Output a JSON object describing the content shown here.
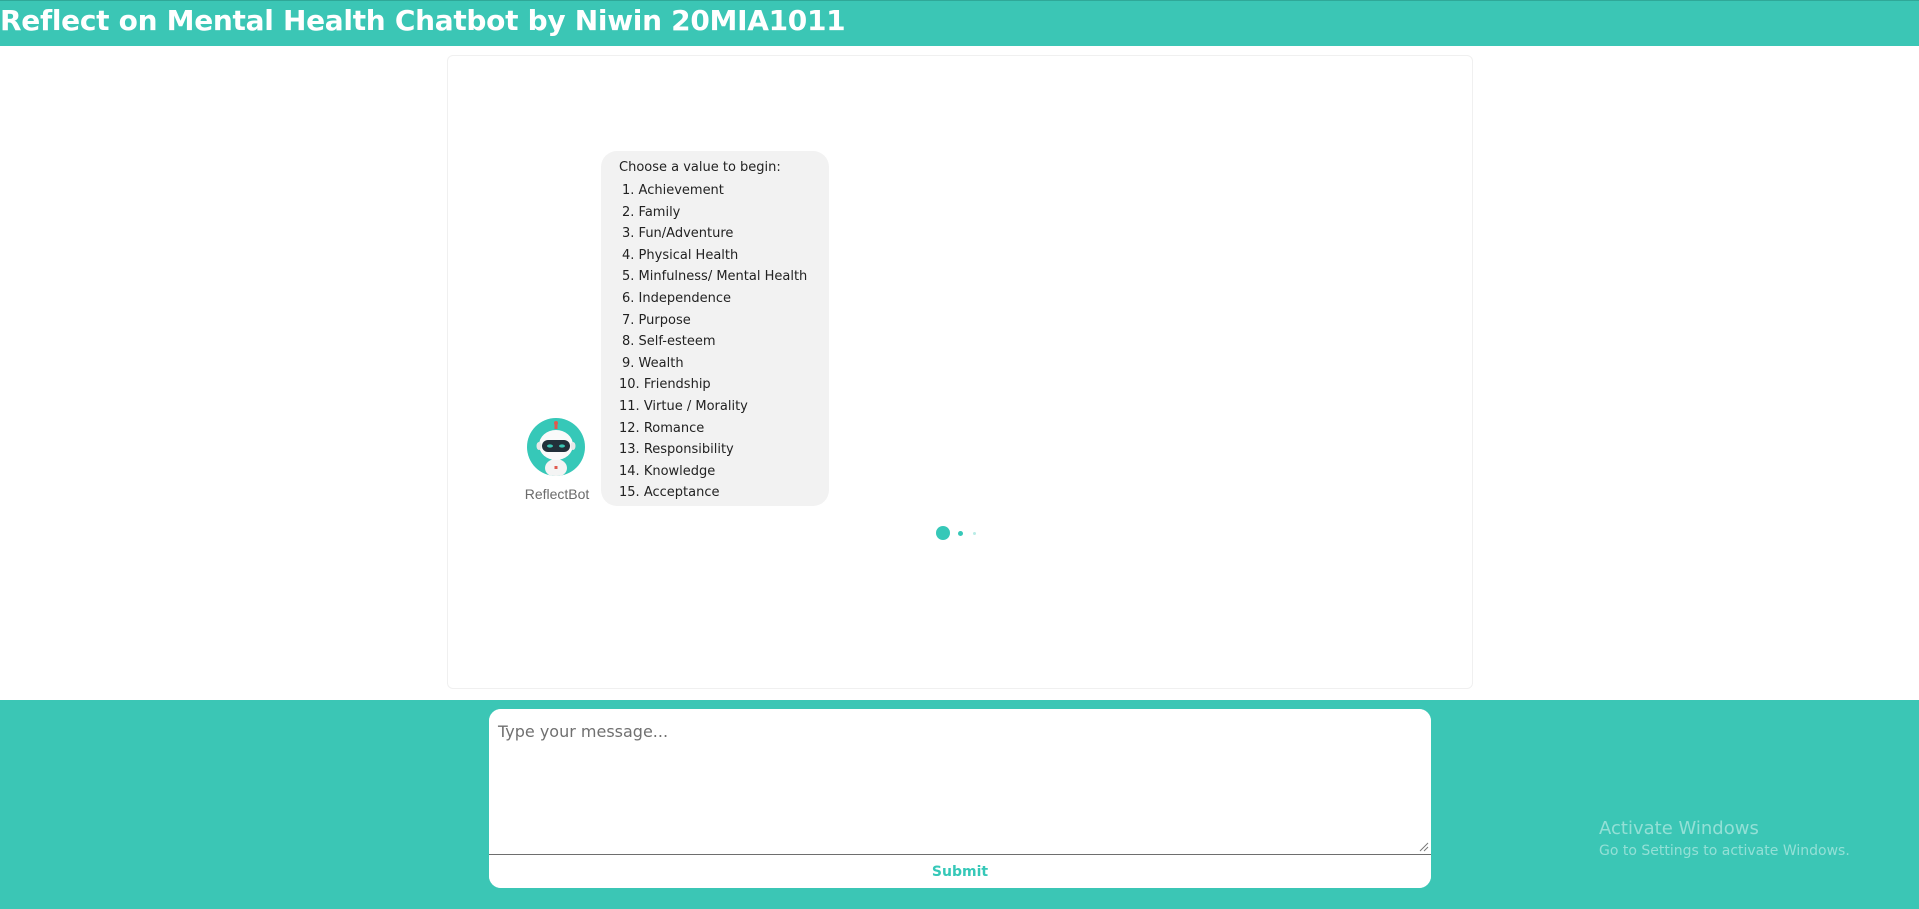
{
  "header": {
    "title": "Reflect on Mental Health Chatbot by Niwin 20MIA1011"
  },
  "bot": {
    "name": "ReflectBot",
    "avatar_icon": "robot-icon"
  },
  "message": {
    "intro": "Choose a value to begin:",
    "options": [
      {
        "num": "1.",
        "label": "Achievement"
      },
      {
        "num": "2.",
        "label": "Family"
      },
      {
        "num": "3.",
        "label": "Fun/Adventure"
      },
      {
        "num": "4.",
        "label": "Physical Health"
      },
      {
        "num": "5.",
        "label": "Minfulness/ Mental Health"
      },
      {
        "num": "6.",
        "label": "Independence"
      },
      {
        "num": "7.",
        "label": "Purpose"
      },
      {
        "num": "8.",
        "label": "Self-esteem"
      },
      {
        "num": "9.",
        "label": "Wealth"
      },
      {
        "num": "10.",
        "label": "Friendship"
      },
      {
        "num": "11.",
        "label": "Virtue / Morality"
      },
      {
        "num": "12.",
        "label": "Romance"
      },
      {
        "num": "13.",
        "label": "Responsibility"
      },
      {
        "num": "14.",
        "label": "Knowledge"
      },
      {
        "num": "15.",
        "label": "Acceptance"
      }
    ]
  },
  "composer": {
    "placeholder": "Type your message...",
    "value": "",
    "submit_label": "Submit"
  },
  "watermark": {
    "line1": "Activate Windows",
    "line2": "Go to Settings to activate Windows."
  },
  "colors": {
    "accent": "#3bc6b5",
    "bubble": "#f2f2f2",
    "text": "#222222"
  }
}
